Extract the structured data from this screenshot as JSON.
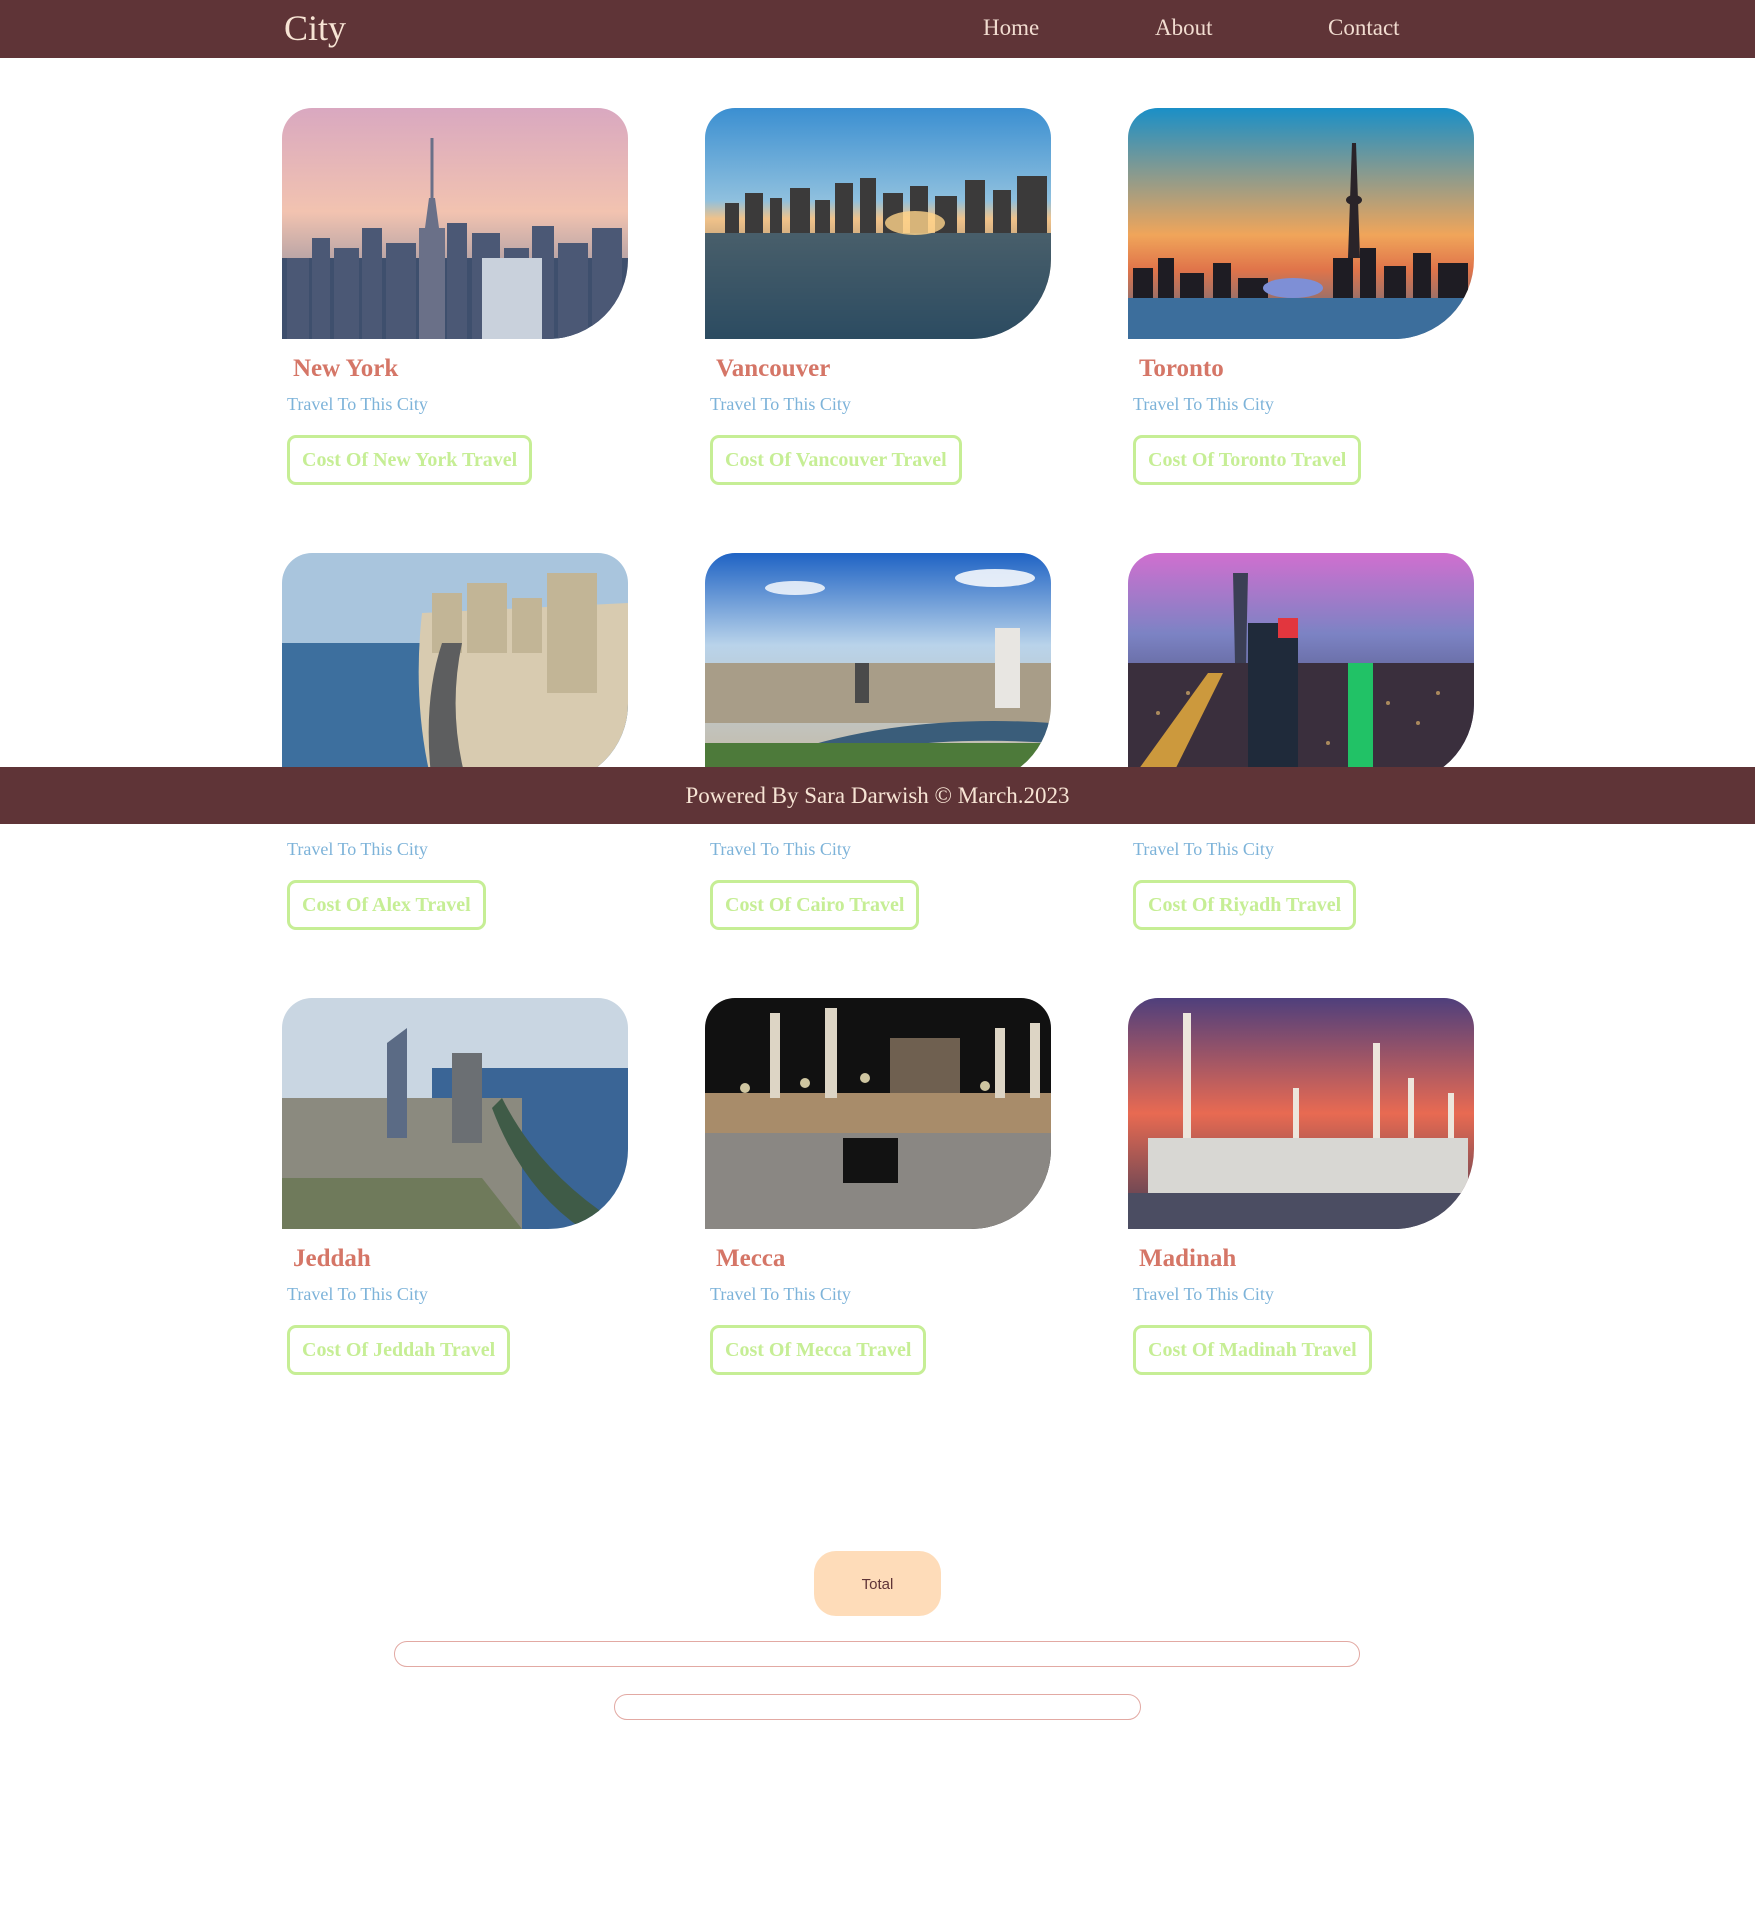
{
  "header": {
    "logo": "City",
    "nav": [
      {
        "label": "Home"
      },
      {
        "label": "About"
      },
      {
        "label": "Contact"
      }
    ]
  },
  "cities": [
    {
      "name": "New York",
      "tagline": "Travel To This City",
      "button": "Cost Of New York Travel",
      "photo": "new-york-skyline-photo"
    },
    {
      "name": "Vancouver",
      "tagline": "Travel To This City",
      "button": "Cost Of Vancouver Travel",
      "photo": "vancouver-harbor-photo"
    },
    {
      "name": "Toronto",
      "tagline": "Travel To This City",
      "button": "Cost Of Toronto Travel",
      "photo": "toronto-cn-tower-photo"
    },
    {
      "name": "",
      "tagline": "Travel To This City",
      "button": "Cost Of Alex Travel",
      "photo": "alexandria-corniche-photo"
    },
    {
      "name": "",
      "tagline": "Travel To This City",
      "button": "Cost Of Cairo Travel",
      "photo": "cairo-nile-photo"
    },
    {
      "name": "",
      "tagline": "Travel To This City",
      "button": "Cost Of Riyadh Travel",
      "photo": "riyadh-night-photo"
    },
    {
      "name": "Jeddah",
      "tagline": "Travel To This City",
      "button": "Cost Of Jeddah Travel",
      "photo": "jeddah-coast-photo"
    },
    {
      "name": "Mecca",
      "tagline": "Travel To This City",
      "button": "Cost Of Mecca Travel",
      "photo": "mecca-kaaba-photo"
    },
    {
      "name": "Madinah",
      "tagline": "Travel To This City",
      "button": "Cost Of Madinah Travel",
      "photo": "madinah-mosque-photo"
    }
  ],
  "footer": {
    "text": "Powered By Sara Darwish © March.2023"
  },
  "total": {
    "button": "Total",
    "field_1": "",
    "field_2": ""
  },
  "colors": {
    "header_bg": "#5f3437",
    "city_name": "#d57667",
    "tagline": "#7db3d9",
    "button_border": "#c6ee95",
    "total_bg": "#fedcb9",
    "input_border": "#e2a9a3"
  }
}
